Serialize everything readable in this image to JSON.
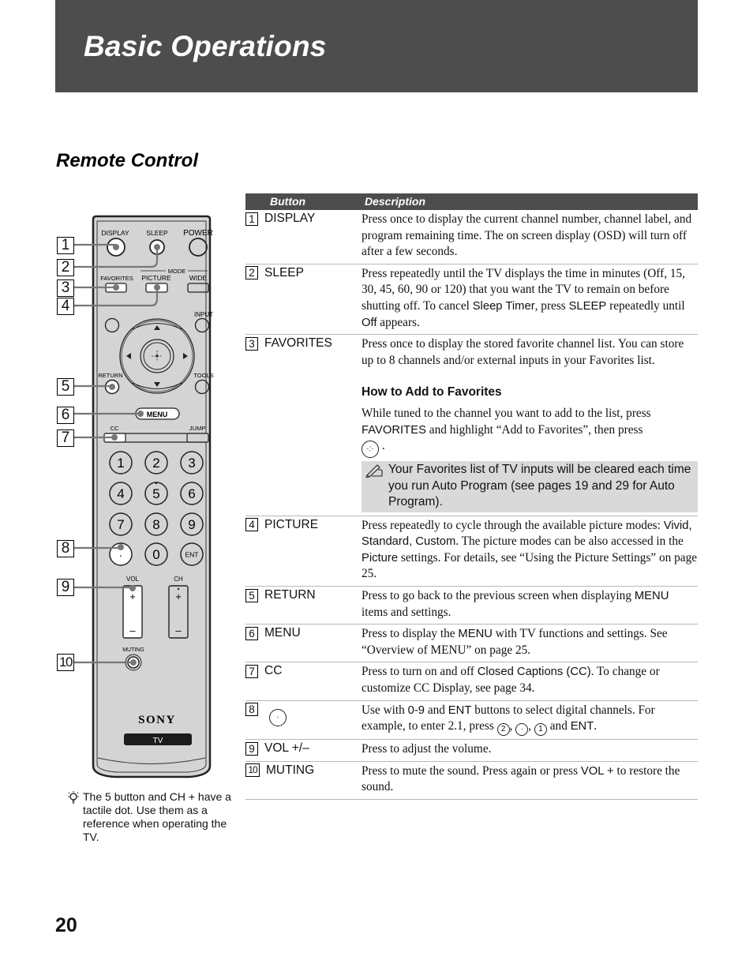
{
  "header": {
    "title": "Basic Operations"
  },
  "section": {
    "title": "Remote Control"
  },
  "table": {
    "headers": {
      "button": "Button",
      "description": "Description"
    },
    "rows": [
      {
        "num": "1",
        "button": "DISPLAY",
        "description": "Press once to display the current channel number, channel label, and program remaining time. The on screen display (OSD) will turn off after a few seconds."
      },
      {
        "num": "2",
        "button": "SLEEP",
        "desc_parts": {
          "a": "Press repeatedly until the TV displays the time in minutes (Off, 15, 30, 45, 60, 90 or 120) that you want the TV to remain on before shutting off. To cancel ",
          "b": "Sleep Timer",
          "c": ", press ",
          "d": "SLEEP",
          "e": " repeatedly until ",
          "f": "Off",
          "g": " appears."
        }
      },
      {
        "num": "3",
        "button": "FAVORITES",
        "description": "Press once to display the stored favorite channel list. You can store up to 8 channels and/or external inputs in your Favorites list.",
        "subheading": "How to Add to Favorites",
        "sub_parts": {
          "a": "While tuned to the channel you want to add to the list, press ",
          "b": "FAVORITES",
          "c": " and highlight “Add to Favorites”, then press ",
          "d": "."
        },
        "note": "Your Favorites list of TV inputs will be cleared each time you run Auto Program (see pages 19 and 29 for Auto Program)."
      },
      {
        "num": "4",
        "button": "PICTURE",
        "desc_parts": {
          "a": "Press repeatedly to cycle through the available picture modes: ",
          "b": "Vivid",
          "c": ", ",
          "d": "Standard",
          "e": ", ",
          "f": "Custom",
          "g": ". The picture modes can be also accessed in the ",
          "h": "Picture",
          "i": " settings. For details, see “Using the Picture Settings” on page 25."
        }
      },
      {
        "num": "5",
        "button": "RETURN",
        "desc_parts": {
          "a": "Press to go back to the previous screen when displaying ",
          "b": "MENU",
          "c": " items and settings."
        }
      },
      {
        "num": "6",
        "button": "MENU",
        "desc_parts": {
          "a": "Press to display the ",
          "b": "MENU",
          "c": " with TV functions and settings. See “Overview of MENU” on page 25."
        }
      },
      {
        "num": "7",
        "button": "CC",
        "desc_parts": {
          "a": "Press to turn on and off ",
          "b": "Closed Captions (CC)",
          "c": ". To change or customize CC Display, see page 34."
        }
      },
      {
        "num": "8",
        "button": "",
        "button_icon": "dot-button-icon",
        "desc_parts": {
          "a": "Use with ",
          "b": "0-9",
          "c": " and ",
          "d": "ENT",
          "e": " buttons to select digital channels. For example, to enter 2.1, press ",
          "f": "2",
          "g": "·",
          "h": "1",
          "i": " and ",
          "j": "ENT",
          "k": "."
        }
      },
      {
        "num": "9",
        "button": "VOL +/–",
        "description": "Press to adjust the volume."
      },
      {
        "num": "10",
        "button": "MUTING",
        "desc_parts": {
          "a": "Press to mute the sound. Press again or press ",
          "b": "VOL +",
          "c": " to restore the sound."
        }
      }
    ]
  },
  "remote": {
    "labels": {
      "display": "DISPLAY",
      "sleep": "SLEEP",
      "power": "POWER",
      "mode": "MODE",
      "favorites": "FAVORITES",
      "picture": "PICTURE",
      "wide": "WIDE",
      "input": "INPUT",
      "return": "RETURN",
      "tools": "TOOLS",
      "menu": "MENU",
      "cc": "CC",
      "jump": "JUMP",
      "vol": "VOL",
      "ch": "CH",
      "muting": "MUTING",
      "brand": "SONY",
      "tv": "TV",
      "ent": "ENT",
      "plus": "+",
      "minus": "–"
    },
    "digits": [
      "1",
      "2",
      "3",
      "4",
      "5",
      "6",
      "7",
      "8",
      "9",
      "·",
      "0"
    ],
    "callouts": [
      "1",
      "2",
      "3",
      "4",
      "5",
      "6",
      "7",
      "8",
      "9",
      "10"
    ]
  },
  "tip": {
    "text": "The 5 button and CH + have a tactile dot. Use them as a reference when operating the TV."
  },
  "footer": {
    "page_number": "20"
  }
}
